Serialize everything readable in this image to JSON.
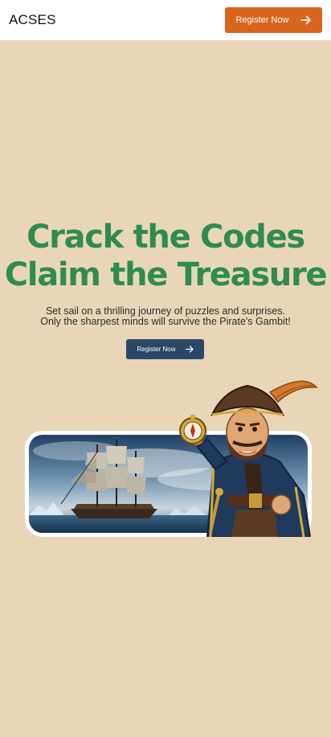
{
  "nav": {
    "logo": "ACSES",
    "register_label": "Register Now",
    "arrow_icon": "arrow-right-icon"
  },
  "hero": {
    "title_line1": "Crack the Codes",
    "title_line2": "Claim the Treasure",
    "subtitle_line1": "Set sail on a thrilling journey of puzzles and surprises.",
    "subtitle_line2": "Only the sharpest minds will survive the Pirate's Gambit!",
    "register_label": "Register Now"
  },
  "colors": {
    "background": "#e9d6b8",
    "accent_orange": "#d8641e",
    "title_green": "#2f8b52",
    "button_navy": "#2c4667"
  },
  "banner": {
    "ship_image": "pirate-ship-illustration",
    "pirate_image": "pirate-with-compass-illustration"
  }
}
